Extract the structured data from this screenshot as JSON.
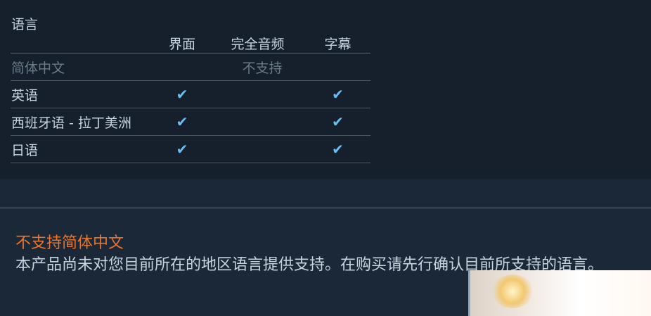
{
  "languages": {
    "heading": "语言",
    "columns": {
      "interface": "界面",
      "full_audio": "完全音频",
      "subtitles": "字幕"
    },
    "rows": [
      {
        "name": "简体中文",
        "note": "不支持",
        "interface": "",
        "full_audio": "",
        "subtitles": ""
      },
      {
        "name": "英语",
        "interface": "✔",
        "full_audio": "",
        "subtitles": "✔"
      },
      {
        "name": "西班牙语 - 拉丁美洲",
        "interface": "✔",
        "full_audio": "",
        "subtitles": "✔"
      },
      {
        "name": "日语",
        "interface": "✔",
        "full_audio": "",
        "subtitles": "✔"
      }
    ]
  },
  "notice": {
    "title": "不支持简体中文",
    "body": "本产品尚未对您目前所在的地区语言提供支持。在购买请先行确认目前所支持的语言。"
  },
  "colors": {
    "accent_orange": "#e8742b",
    "check_blue": "#66c0f4",
    "background": "#1b2838"
  }
}
